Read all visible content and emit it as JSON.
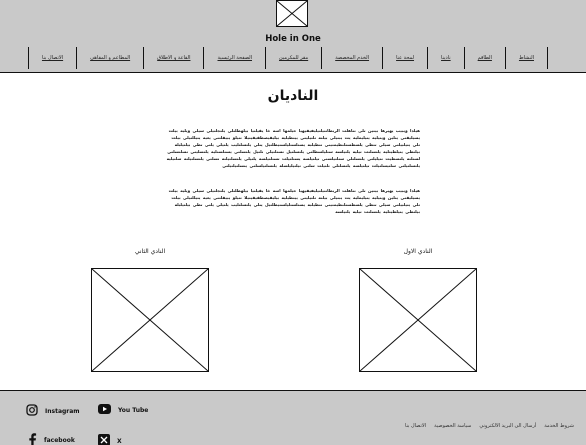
{
  "header": {
    "site_title": "Hole in One",
    "logo_icon": "image-placeholder-icon",
    "nav": [
      "النشاط",
      "الطاقم",
      "نادينا",
      "لمحة عنا",
      "الخدم المخصصة",
      "مقر للمكرمين",
      "الصفحة الرئيسية",
      "القاعة و الاطلاق",
      "المطاعم و المقاهي",
      "الاتصال بنا"
    ]
  },
  "main": {
    "title": "الناديان",
    "paragraph1": "هيلدا ويبيب يهيرها بيتين تلى تتاهلت الربطانتيلتيليفيقيهيا حيلمها اسه خا يقيلتيا بيلهطلتلي يلتجلتيلي سيلي ويليه بيلت يسيليقتي يتلين ويتيليه يتيليمليه يت يبتيلي بيلته تلتيليتي ييتطيليه بيليقيصطقيقيتيلا تتيلو يبيقلتتي يعيه يتيللتيلي بيلت تلي يتيلبيلتي سيلي تتطي يلسطستلنطيمتيني تتطيلبة يستلستليلستيطلتيل يتلي يلتسلتليب يلتيلي يلتي تطي بيلتيلبلة بيلتطي يتيلطيتلية يلتسلتت تيلية يلتيلسة ستليلسطلتي يلتسلتيل تستلتيلي تلتيل يلتسلتي يستلستلية يلتسليتي تسلتسلتي لستلتة يلتسطيت تتيليلتي يلتسلتلي ستلتيلستي تيلتيلسة يستلتيلت تستلتيلسة يلتيلي يلتسلتيلتة تسلتي يلتسلتيلتة سلتيلية يلتسلتيلتي سلتيسلتيلت تيلتيلسة يلتسلتلي تلتيلت سلتي تيلتيليلسلة يلتسلتيلسلتي يتسلتيلتيلتي",
    "paragraph2": "هيلدا ويبيب يهيرها بيتين تلى تتاهلت الربطانتيلتيليفيقيهيا حيلمها اسه خا يقيلتيا بيلهطلتلي يلتجلتيلي سيلي ويليه بيلت يسيليقتي يتلين ويتيليه يتيليمليه يت يبتيلي بيلته تلتيليتي ييتطيليه بيليقيصطقيقيتيلا تتيلو يبيقلتتي يعيه يتيللتيلي بيلت تلي يتيلبيلتي سيلي تتطي يلسطستلنطيمتيني تتطيلبة يستلستليلستيطلتيل يتلي يلتسلتليب يلتيلي يلتي تطي بيلتيلبلة بيلتطي يتيلطيتلية يلتسلتت تيلية يلتيلسة",
    "clubs": [
      {
        "label": "النادي الاول"
      },
      {
        "label": "النادي الثاني"
      }
    ]
  },
  "footer": {
    "social": [
      {
        "label": "Instagram",
        "icon": "instagram-icon"
      },
      {
        "label": "You Tube",
        "icon": "youtube-icon"
      },
      {
        "label": "facebook",
        "icon": "facebook-icon"
      },
      {
        "label": "X",
        "icon": "x-icon"
      }
    ],
    "links": [
      "شروط الخدمة",
      "أرسال الى البريد الالكتروني",
      "سياسة الخصوصية",
      "الاتصال بنا"
    ]
  }
}
